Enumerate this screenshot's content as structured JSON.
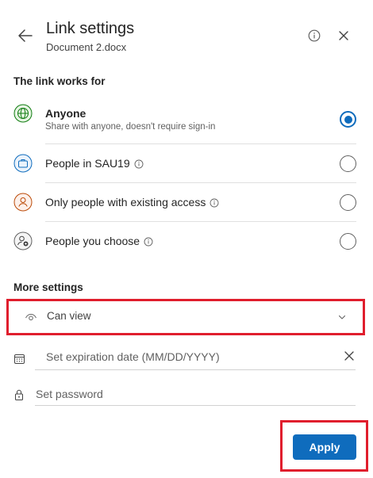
{
  "header": {
    "title": "Link settings",
    "file_name": "Document 2.docx"
  },
  "link_works_for": {
    "heading": "The link works for",
    "options": [
      {
        "label": "Anyone",
        "description": "Share with anyone, doesn't require sign-in",
        "selected": true,
        "icon": "globe-icon"
      },
      {
        "label": "People in SAU19",
        "selected": false,
        "icon": "briefcase-icon"
      },
      {
        "label": "Only people with existing access",
        "selected": false,
        "icon": "person-icon"
      },
      {
        "label": "People you choose",
        "selected": false,
        "icon": "people-icon"
      }
    ]
  },
  "more_settings": {
    "heading": "More settings",
    "permission": "Can view",
    "expiration_placeholder": "Set expiration date (MM/DD/YYYY)",
    "password_placeholder": "Set password"
  },
  "footer": {
    "apply_label": "Apply"
  },
  "colors": {
    "accent": "#0f6cbd",
    "highlight": "#e01e2d"
  }
}
